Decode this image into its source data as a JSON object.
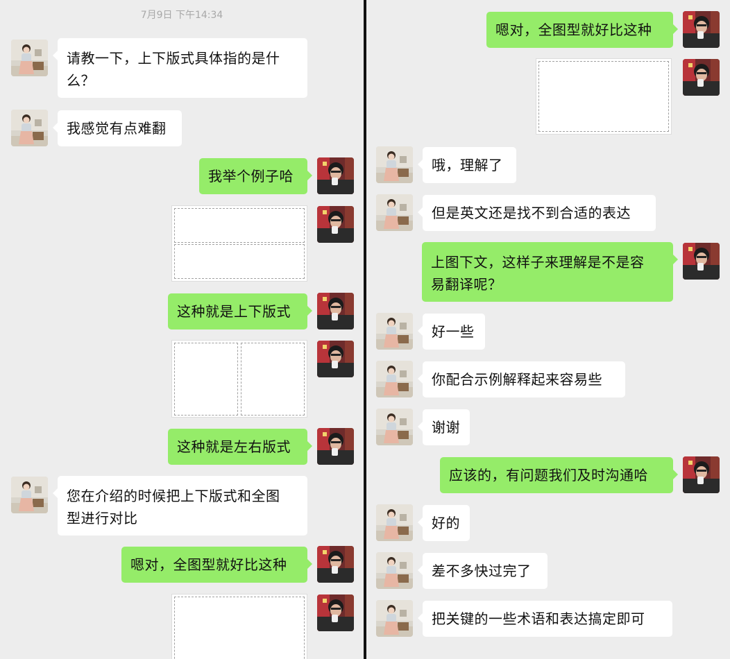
{
  "timestamp": "7月9日 下午14:34",
  "left_messages": [
    {
      "text": "请教一下，上下版式具体指的是什么？",
      "line1": "请教一下，上下版式具体指的是什",
      "line2": "么？"
    },
    {
      "text": "我感觉有点难翻"
    },
    {
      "text": "我举个例子哈"
    },
    {
      "text": "这种就是上下版式"
    },
    {
      "text": "这种就是左右版式"
    },
    {
      "text": "您在介绍的时候把上下版式和全图型进行对比",
      "line1": "您在介绍的时候把上下版式和全图",
      "line2": "型进行对比"
    },
    {
      "text": "嗯对，全图型就好比这种"
    }
  ],
  "right_messages": [
    {
      "text": "嗯对，全图型就好比这种"
    },
    {
      "text": "哦，理解了"
    },
    {
      "text": "但是英文还是找不到合适的表达"
    },
    {
      "text": "上图下文，这样子来理解是不是容易翻译呢？",
      "line1": "上图下文，这样子来理解是不是容",
      "line2": "易翻译呢？"
    },
    {
      "text": "好一些"
    },
    {
      "text": "你配合示例解释起来容易些"
    },
    {
      "text": "谢谢"
    },
    {
      "text": "应该的，有问题我们及时沟通哈"
    },
    {
      "text": "好的"
    },
    {
      "text": "差不多快过完了"
    },
    {
      "text": "把关键的一些术语和表达搞定即可"
    }
  ],
  "colors": {
    "background": "#ededed",
    "incoming_bubble": "#ffffff",
    "outgoing_bubble": "#95ec69",
    "timestamp": "#a8a8a8"
  }
}
